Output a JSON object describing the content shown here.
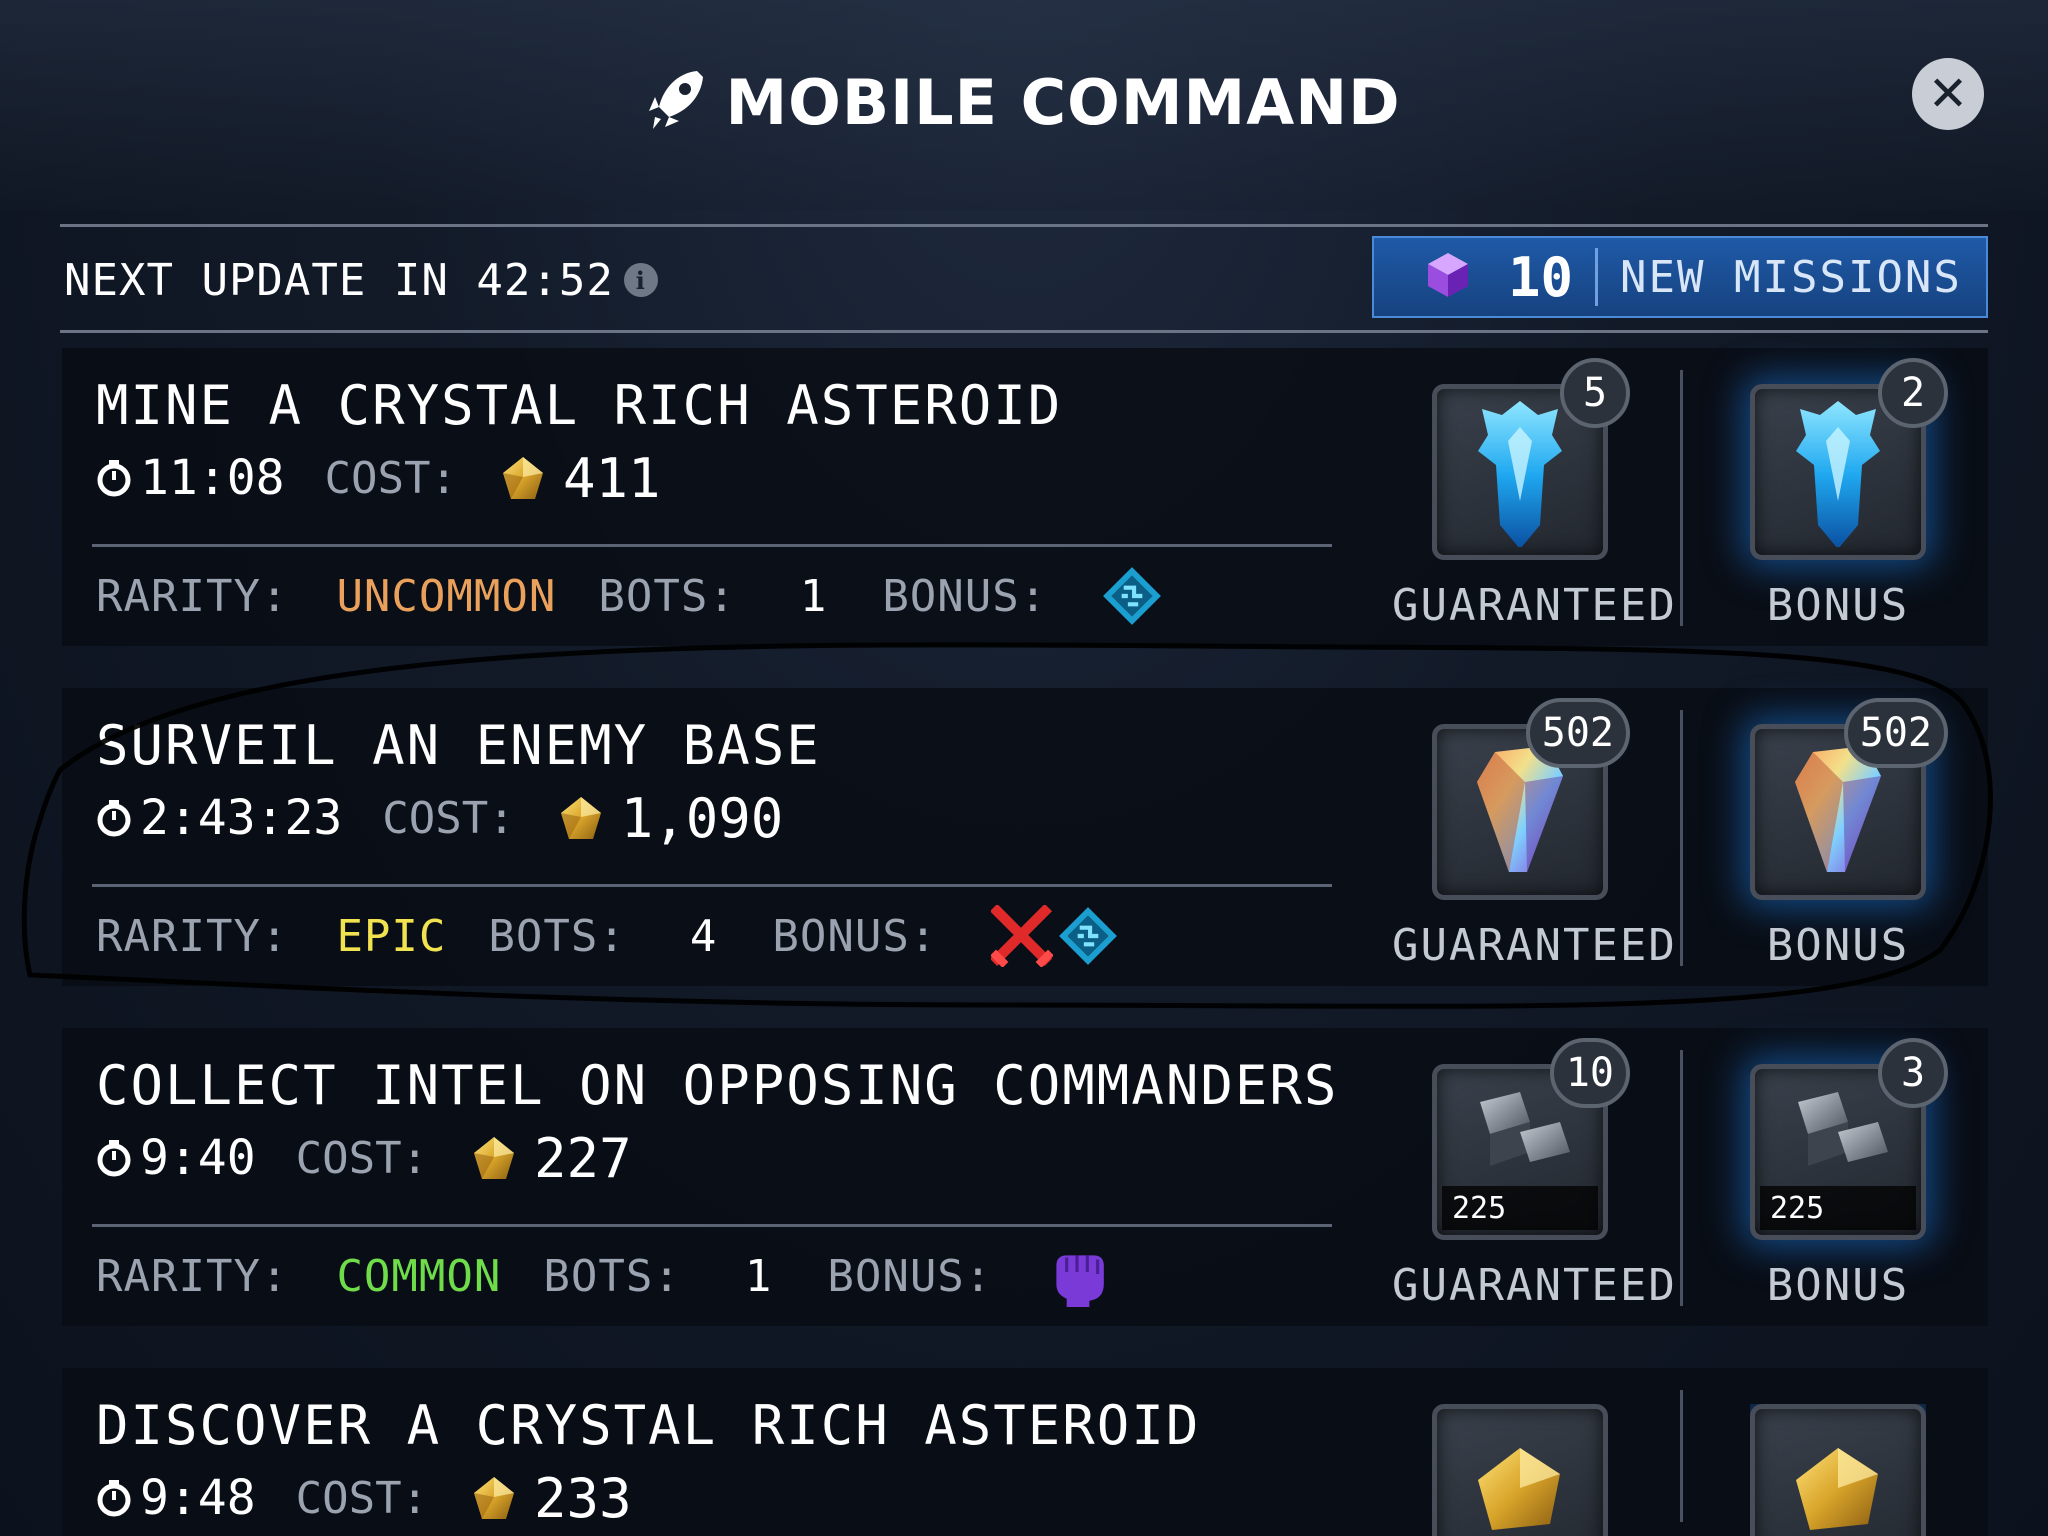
{
  "header": {
    "title": "MOBILE COMMAND",
    "close_label": "✕"
  },
  "status": {
    "next_update": "NEXT UPDATE IN 42:52",
    "new_missions_count": "10",
    "new_missions_label": "NEW MISSIONS"
  },
  "labels": {
    "cost": "COST:",
    "rarity": "RARITY:",
    "bots": "BOTS:",
    "bonus": "BONUS:",
    "guaranteed": "GUARANTEED",
    "bonus_reward": "BONUS"
  },
  "missions": [
    {
      "title": "MINE A CRYSTAL RICH ASTEROID",
      "time": "11:08",
      "cost": "411",
      "rarity": "UNCOMMON",
      "bots": "1",
      "bonus_icons": [
        "chip-icon"
      ],
      "guaranteed_qty": "5",
      "bonus_qty": "2",
      "reward_icon": "blue-armor-shard-icon"
    },
    {
      "title": "SURVEIL AN ENEMY BASE",
      "time": "2:43:23",
      "cost": "1,090",
      "rarity": "EPIC",
      "bots": "4",
      "bonus_icons": [
        "crossed-swords-icon",
        "chip-icon"
      ],
      "guaranteed_qty": "502",
      "bonus_qty": "502",
      "reward_icon": "prismatic-crystal-icon"
    },
    {
      "title": "COLLECT INTEL ON OPPOSING COMMANDERS",
      "time": "9:40",
      "cost": "227",
      "rarity": "COMMON",
      "bots": "1",
      "bonus_icons": [
        "fist-icon"
      ],
      "guaranteed_qty": "10",
      "bonus_qty": "3",
      "guaranteed_sub": "225",
      "bonus_sub": "225",
      "reward_icon": "metal-alloy-icon"
    },
    {
      "title": "DISCOVER A CRYSTAL RICH ASTEROID",
      "time": "9:48",
      "cost": "233",
      "reward_icon": "gold-ore-icon"
    }
  ],
  "colors": {
    "uncommon": "#e9a15b",
    "epic": "#f1e24f",
    "common": "#6fdc4a",
    "accent_blue": "#1f5aa8",
    "annotation_ink": "#000000"
  }
}
